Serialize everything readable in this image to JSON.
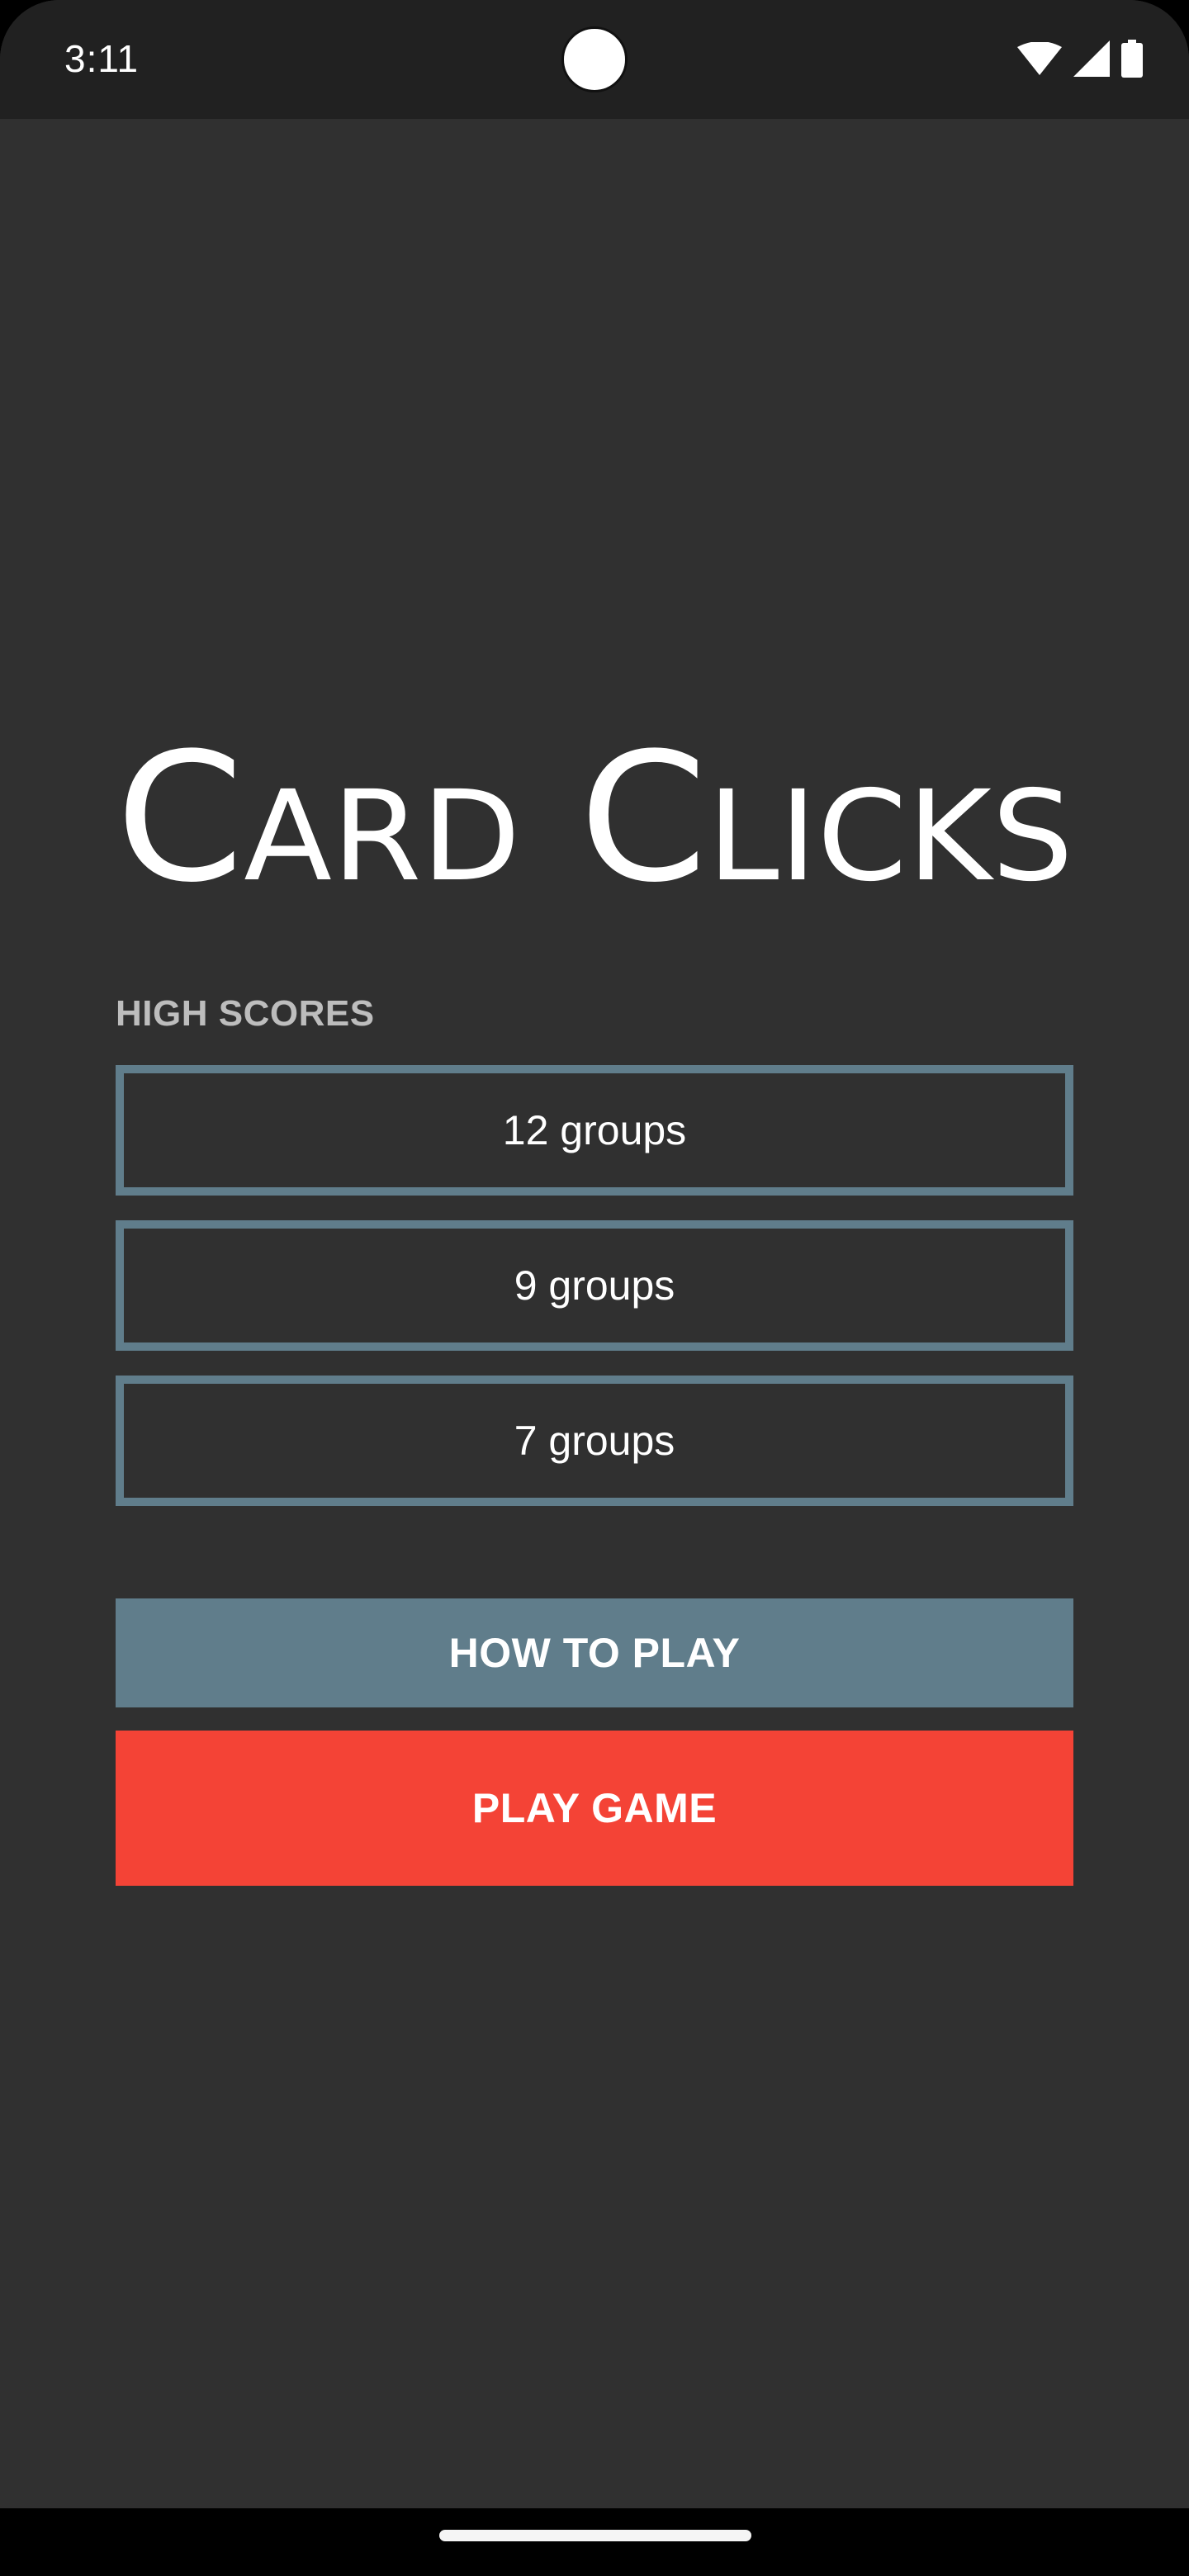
{
  "status_bar": {
    "time": "3:11",
    "icons": [
      "wifi-icon",
      "signal-icon",
      "battery-icon"
    ]
  },
  "app": {
    "title": "Card Clicks"
  },
  "high_scores": {
    "label": "HIGH SCORES",
    "items": [
      "12 groups",
      "9 groups",
      "7 groups"
    ]
  },
  "buttons": {
    "how_to_play": "HOW TO PLAY",
    "play_game": "PLAY GAME"
  },
  "colors": {
    "background": "#303030",
    "status_bar": "#212121",
    "accent_slate": "#607d8b",
    "accent_red": "#f44336",
    "label_gray": "#bdbdbd"
  }
}
